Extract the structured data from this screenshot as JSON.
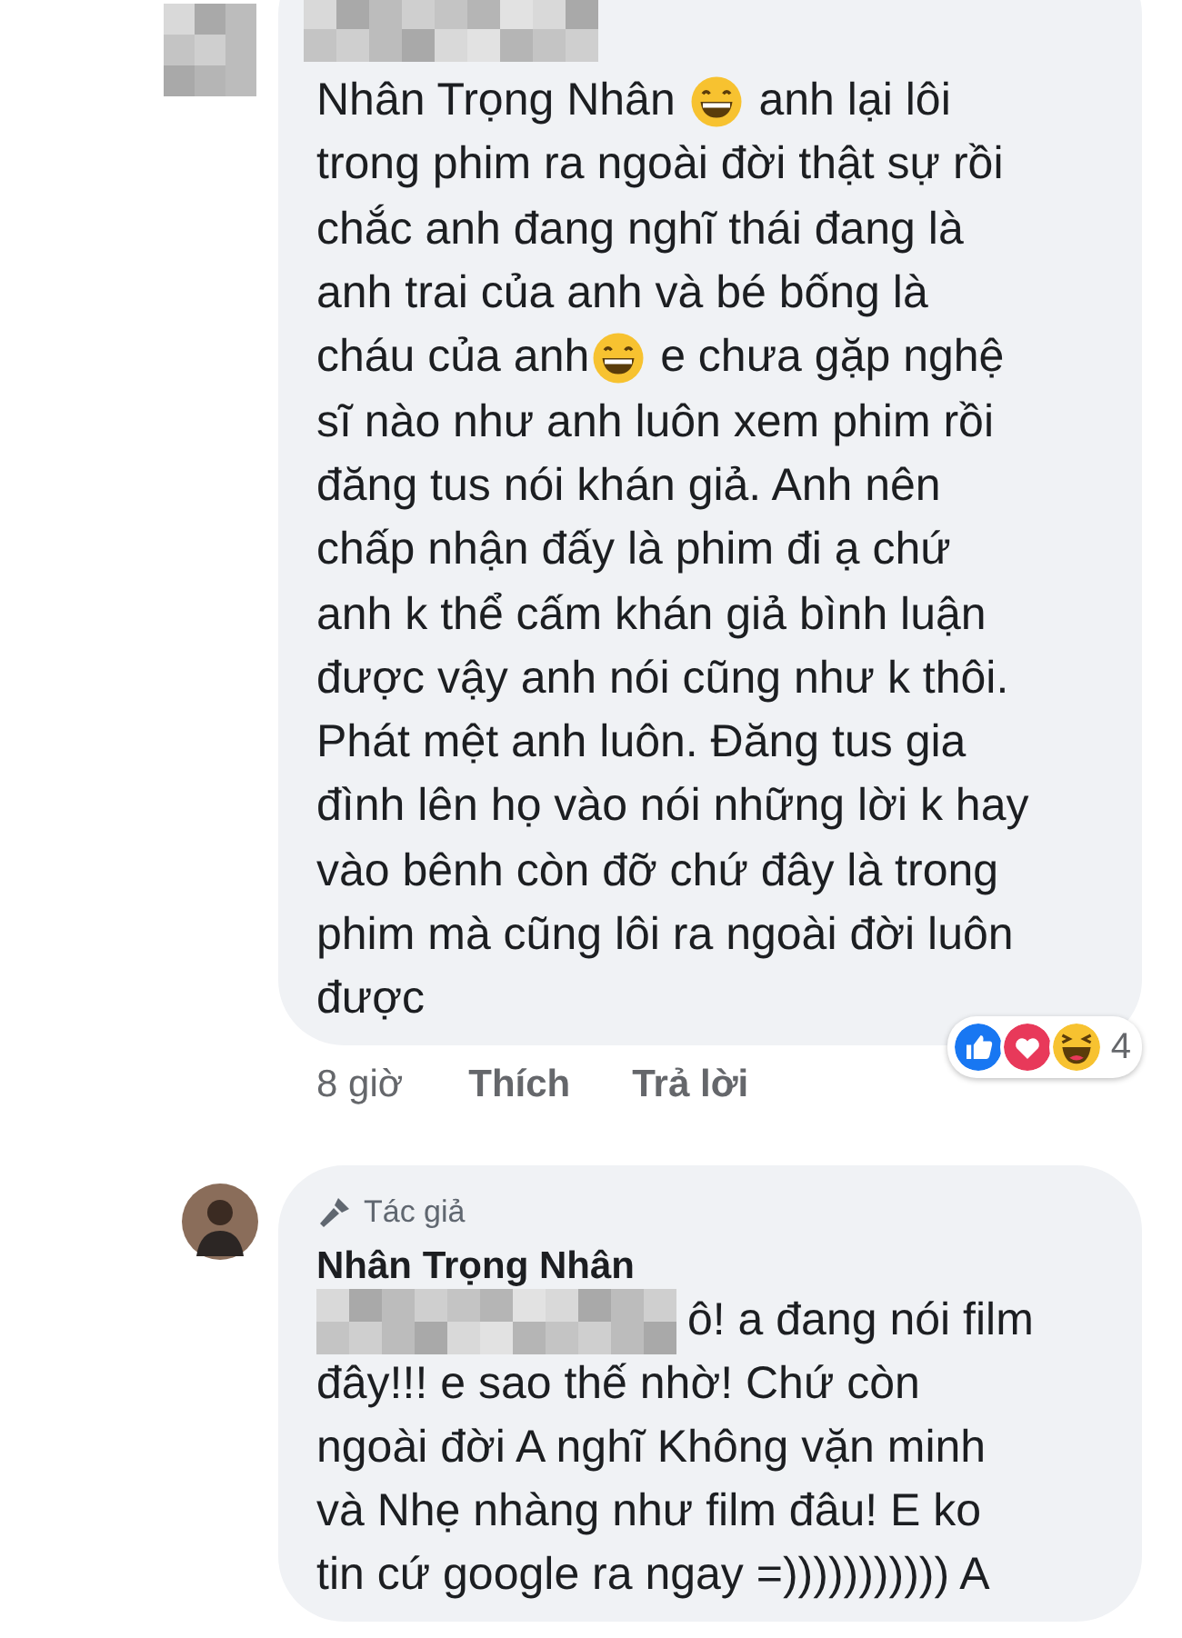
{
  "comments": [
    {
      "lines": [
        [
          {
            "kind": "text",
            "text": "Nhân Trọng Nhân "
          },
          {
            "kind": "emoji"
          },
          {
            "kind": "text",
            "text": " anh lại lôi"
          }
        ],
        [
          {
            "kind": "text",
            "text": "trong phim ra ngoài đời thật sự rồi"
          }
        ],
        [
          {
            "kind": "text",
            "text": "chắc anh đang nghĩ thái đang là"
          }
        ],
        [
          {
            "kind": "text",
            "text": "anh trai của anh và bé bống là"
          }
        ],
        [
          {
            "kind": "text",
            "text": "cháu của anh"
          },
          {
            "kind": "emoji"
          },
          {
            "kind": "text",
            "text": " e chưa gặp nghệ"
          }
        ],
        [
          {
            "kind": "text",
            "text": "sĩ nào như anh luôn xem phim rồi"
          }
        ],
        [
          {
            "kind": "text",
            "text": "đăng tus nói khán giả. Anh nên"
          }
        ],
        [
          {
            "kind": "text",
            "text": "chấp nhận đấy là phim đi ạ chứ"
          }
        ],
        [
          {
            "kind": "text",
            "text": "anh k thể cấm khán giả bình luận"
          }
        ],
        [
          {
            "kind": "text",
            "text": "được vậy anh nói cũng như k thôi."
          }
        ],
        [
          {
            "kind": "text",
            "text": "Phát mệt anh luôn. Đăng tus gia"
          }
        ],
        [
          {
            "kind": "text",
            "text": "đình lên họ vào nói những lời k hay"
          }
        ],
        [
          {
            "kind": "text",
            "text": "vào bênh còn đỡ chứ đây là trong"
          }
        ],
        [
          {
            "kind": "text",
            "text": "phim mà cũng lôi ra ngoài đời luôn"
          }
        ],
        [
          {
            "kind": "text",
            "text": "được"
          }
        ]
      ],
      "time": "8 giờ",
      "like": "Thích",
      "reply": "Trả lời",
      "reaction_count": "4"
    },
    {
      "author_label": "Tác giả",
      "name": "Nhân Trọng Nhân",
      "lines": [
        [
          {
            "kind": "redacted"
          },
          {
            "kind": "text",
            "text": "ô! a đang nói film"
          }
        ],
        [
          {
            "kind": "text",
            "text": "đây!!! e sao thế nhờ! Chứ còn"
          }
        ],
        [
          {
            "kind": "text",
            "text": "ngoài đời A nghĩ Không vặn minh"
          }
        ],
        [
          {
            "kind": "text",
            "text": "và Nhẹ nhàng như film đâu! E ko"
          }
        ],
        [
          {
            "kind": "text",
            "text": "tin cứ google ra ngay =))))))))))) A"
          }
        ]
      ]
    }
  ]
}
